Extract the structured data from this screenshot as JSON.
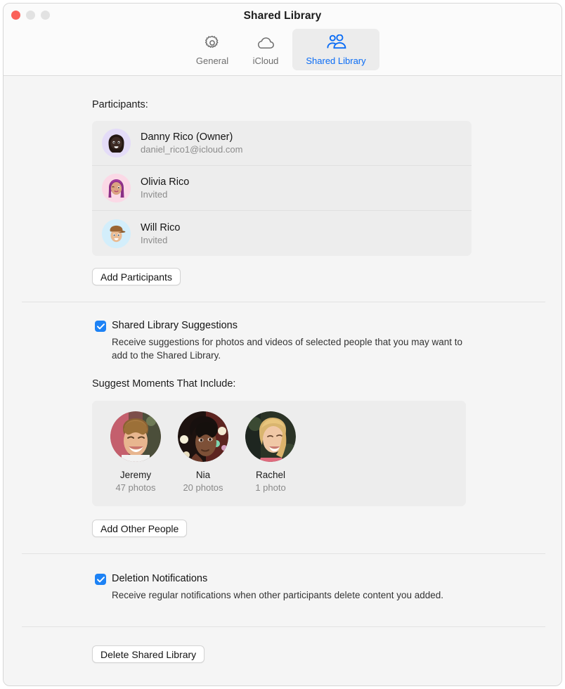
{
  "window": {
    "title": "Shared Library",
    "traffic_lights": [
      "close",
      "minimize",
      "maximize"
    ]
  },
  "toolbar": {
    "tabs": [
      {
        "label": "General",
        "icon": "gear-icon",
        "selected": false
      },
      {
        "label": "iCloud",
        "icon": "cloud-icon",
        "selected": false
      },
      {
        "label": "Shared Library",
        "icon": "people-two-icon",
        "selected": true
      }
    ],
    "selected_color": "#0a6cf5",
    "unselected_color": "#6e6e6e"
  },
  "participants_section": {
    "heading": "Participants:",
    "rows": [
      {
        "name": "Danny Rico (Owner)",
        "subtitle": "daniel_rico1@icloud.com",
        "avatar": {
          "bg": "#e4dcf8",
          "skin": "#3d2a24",
          "hair": "#241713",
          "type": "memoji-bearded-man"
        }
      },
      {
        "name": "Olivia Rico",
        "subtitle": "Invited",
        "avatar": {
          "bg": "#fbd9e6",
          "skin": "#d8a280",
          "hair": "#8b2f86",
          "type": "memoji-woman-purple-hair"
        }
      },
      {
        "name": "Will Rico",
        "subtitle": "Invited",
        "avatar": {
          "bg": "#d3eefb",
          "skin": "#e2b48e",
          "hair": "#8a5a32",
          "type": "memoji-boy-cap"
        }
      }
    ],
    "add_button": "Add Participants"
  },
  "suggestions_section": {
    "checkbox_label": "Shared Library Suggestions",
    "checkbox_checked": true,
    "description": "Receive suggestions for photos and videos of selected people that you may want to add to the Shared Library.",
    "moments_heading": "Suggest Moments That Include:",
    "people": [
      {
        "name": "Jeremy",
        "count": "47 photos"
      },
      {
        "name": "Nia",
        "count": "20 photos"
      },
      {
        "name": "Rachel",
        "count": "1 photo"
      }
    ],
    "add_button": "Add Other People"
  },
  "deletion_section": {
    "checkbox_label": "Deletion Notifications",
    "checkbox_checked": true,
    "description": "Receive regular notifications when other participants delete content you added."
  },
  "footer": {
    "delete_button": "Delete Shared Library"
  },
  "colors": {
    "accent": "#1d82f5",
    "link": "#0a6cf5",
    "window_bg": "#f5f5f5",
    "panel_bg": "#ededed"
  }
}
